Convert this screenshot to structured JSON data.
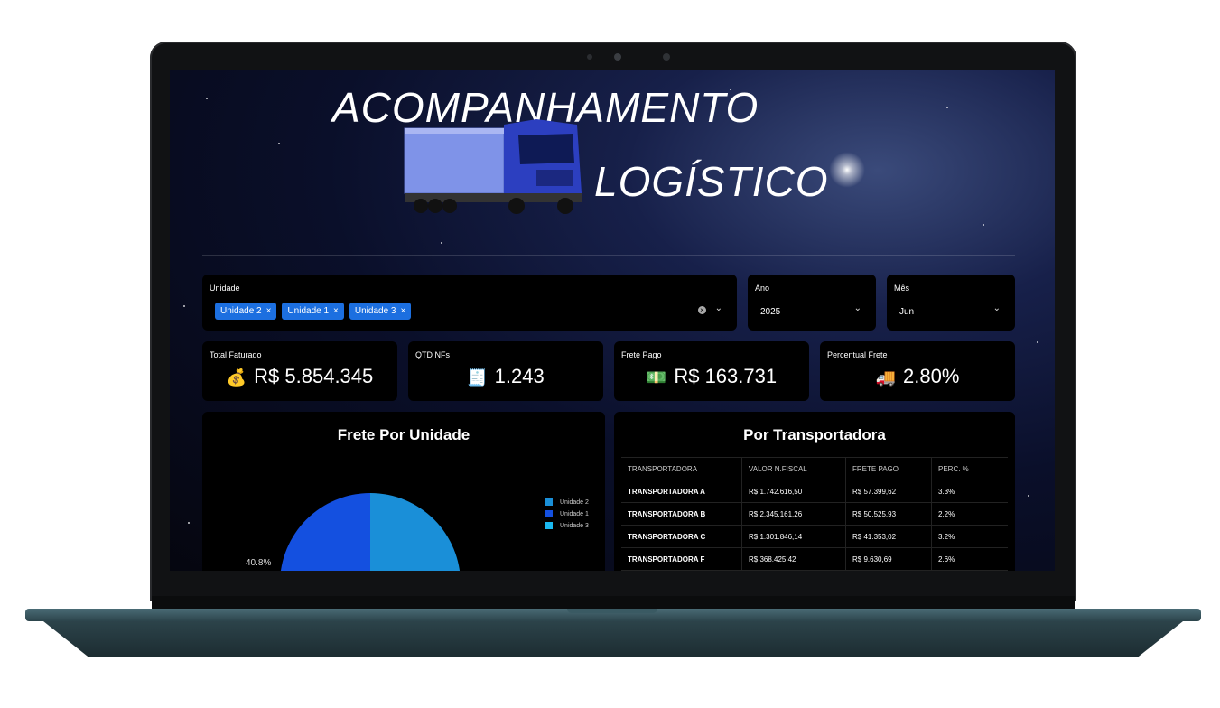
{
  "header": {
    "title_line1": "ACOMPANHAMENTO",
    "title_line2": "LOGÍSTICO"
  },
  "filters": {
    "unidade": {
      "label": "Unidade",
      "tags": [
        "Unidade 2",
        "Unidade 1",
        "Unidade 3"
      ],
      "remove_glyph": "×"
    },
    "ano": {
      "label": "Ano",
      "value": "2025"
    },
    "mes": {
      "label": "Mês",
      "value": "Jun"
    },
    "chevron": "⌄",
    "clear_glyph": "×"
  },
  "kpis": [
    {
      "label": "Total Faturado",
      "icon": "money-bag-icon",
      "emoji": "💰",
      "value": "R$ 5.854.345"
    },
    {
      "label": "QTD NFs",
      "icon": "receipt-icon",
      "emoji": "🧾",
      "value": "1.243"
    },
    {
      "label": "Frete Pago",
      "icon": "money-icon",
      "emoji": "💵",
      "value": "R$ 163.731"
    },
    {
      "label": "Percentual Frete",
      "icon": "truck-icon",
      "emoji": "🚚",
      "value": "2.80%"
    }
  ],
  "pie_chart": {
    "title": "Frete Por Unidade",
    "legend": [
      {
        "name": "Unidade 2",
        "color": "#1a8fd8"
      },
      {
        "name": "Unidade 1",
        "color": "#1450e0"
      },
      {
        "name": "Unidade 3",
        "color": "#1ab8f0"
      }
    ],
    "visible_label": "40.8%"
  },
  "table": {
    "title": "Por Transportadora",
    "columns": [
      "TRANSPORTADORA",
      "VALOR N.FISCAL",
      "FRETE PAGO",
      "PERC. %"
    ],
    "rows": [
      [
        "TRANSPORTADORA A",
        "R$ 1.742.616,50",
        "R$ 57.399,62",
        "3.3%"
      ],
      [
        "TRANSPORTADORA B",
        "R$ 2.345.161,26",
        "R$ 50.525,93",
        "2.2%"
      ],
      [
        "TRANSPORTADORA C",
        "R$ 1.301.846,14",
        "R$ 41.353,02",
        "3.2%"
      ],
      [
        "TRANSPORTADORA F",
        "R$ 368.425,42",
        "R$ 9.630,69",
        "2.6%"
      ]
    ]
  }
}
